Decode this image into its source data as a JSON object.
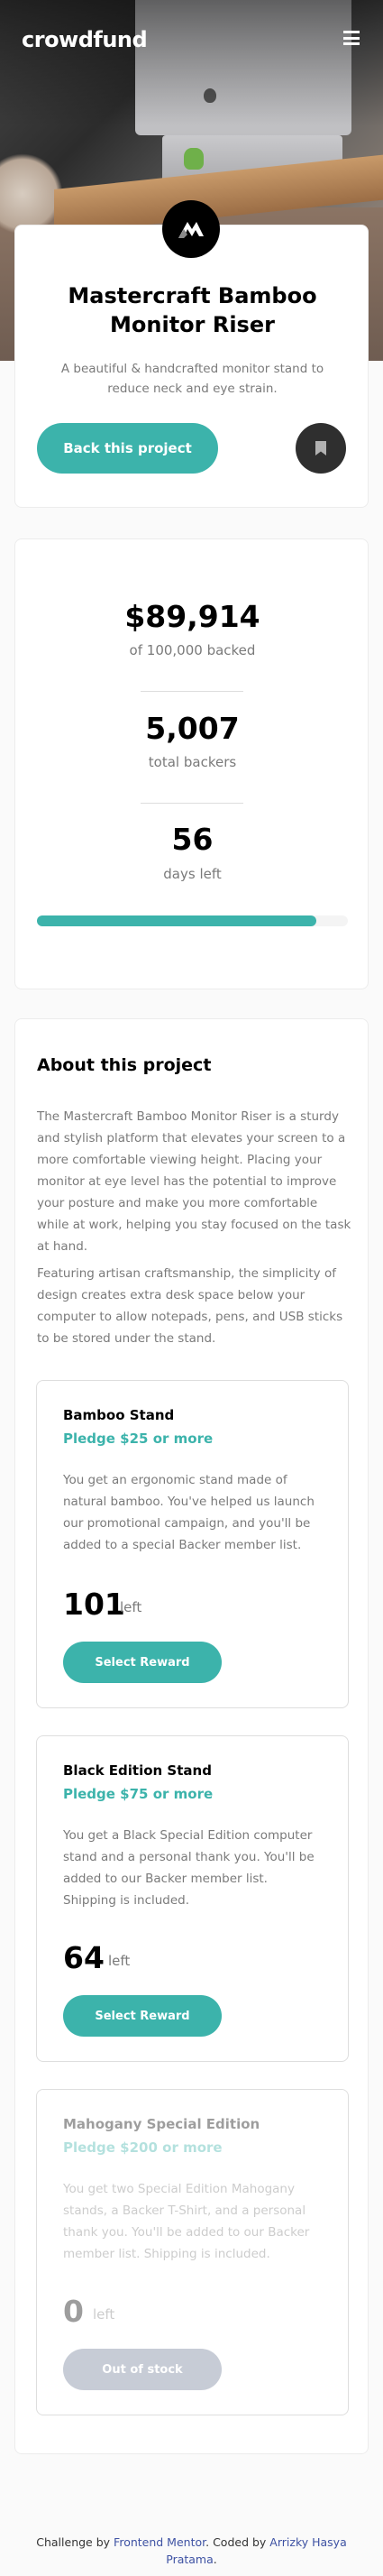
{
  "header": {
    "logo": "crowdfund"
  },
  "project": {
    "title": "Mastercraft Bamboo Monitor Riser",
    "description": "A beautiful & handcrafted monitor stand to reduce neck and eye strain.",
    "back_button": "Back this project"
  },
  "stats": {
    "amount": "$89,914",
    "amount_label": "of 100,000 backed",
    "backers": "5,007",
    "backers_label": "total backers",
    "days": "56",
    "days_label": "days left",
    "progress_fraction": 0.89914
  },
  "about": {
    "heading": "About this project",
    "paragraph_1": "The Mastercraft Bamboo Monitor Riser is a sturdy and stylish platform that elevates your screen to a more comfortable viewing height. Placing your monitor at eye level has the potential to improve your posture and make you more comfortable while at work, helping you stay focused on the task at hand.",
    "paragraph_2": "Featuring artisan craftsmanship, the simplicity of design creates extra desk space below your computer to allow notepads, pens, and USB sticks to be stored under the stand."
  },
  "rewards": [
    {
      "name": "Bamboo Stand",
      "pledge": "Pledge $25 or more",
      "description": "You get an ergonomic stand made of natural bamboo. You've helped us launch our promotional campaign, and you'll be added to a special Backer member list.",
      "count": "101",
      "left_label": "left",
      "button": "Select Reward"
    },
    {
      "name": "Black Edition Stand",
      "pledge": "Pledge $75 or more",
      "description": "You get a Black Special Edition computer stand and a personal thank you. You'll be added to our Backer member list. Shipping is included.",
      "count": "64",
      "left_label": "left",
      "button": "Select Reward"
    },
    {
      "name": "Mahogany Special Edition",
      "pledge": "Pledge $200 or more",
      "description": "You get two Special Edition Mahogany stands, a Backer T-Shirt, and a personal thank you. You'll be added to our Backer member list. Shipping is included.",
      "count": "0",
      "left_label": "left",
      "button": "Out of stock"
    }
  ],
  "footer": {
    "prefix": "Challenge by",
    "challenge_link": "Frontend Mentor",
    "middle": ". Coded by",
    "author_link": "Arrizky Hasya Pratama",
    "suffix": "."
  },
  "colors": {
    "accent": "#3cb3ab",
    "dark": "#2f2f2f",
    "muted_text": "#7a7a7a",
    "disabled_button": "#c7ccd6"
  },
  "icons": {
    "menu": "hamburger-icon",
    "bookmark": "bookmark-icon",
    "project_logo": "mastercraft-logo-icon"
  }
}
